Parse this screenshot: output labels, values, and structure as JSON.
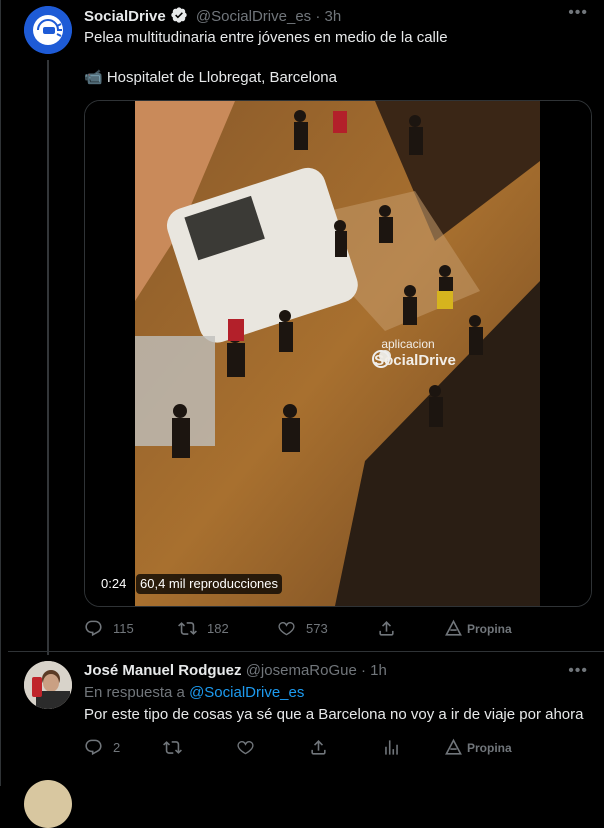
{
  "tweet1": {
    "author_name": "SocialDrive",
    "handle": "@SocialDrive_es",
    "time": "3h",
    "text": "Pelea multitudinaria entre jóvenes en medio de la calle",
    "location": "📹 Hospitalet de Llobregat, Barcelona",
    "video": {
      "duration": "0:24",
      "views": "60,4 mil reproducciones",
      "watermark_line1": "aplicacion",
      "watermark_line2": "SocialDrive"
    },
    "actions": {
      "replies": "115",
      "retweets": "182",
      "likes": "573",
      "tip": "Propina"
    }
  },
  "tweet2": {
    "author_name": "José Manuel Rodguez",
    "handle": "@josemaRoGue",
    "time": "1h",
    "reply_prefix": "En respuesta a",
    "reply_to": "@SocialDrive_es",
    "text": "Por este tipo de cosas ya sé que a Barcelona no voy a ir de viaje por ahora",
    "actions": {
      "replies": "2",
      "tip": "Propina"
    }
  },
  "colors": {
    "accent": "#1d9bf0",
    "muted": "#71767b",
    "text": "#e7e9ea",
    "border": "#2f3336"
  }
}
